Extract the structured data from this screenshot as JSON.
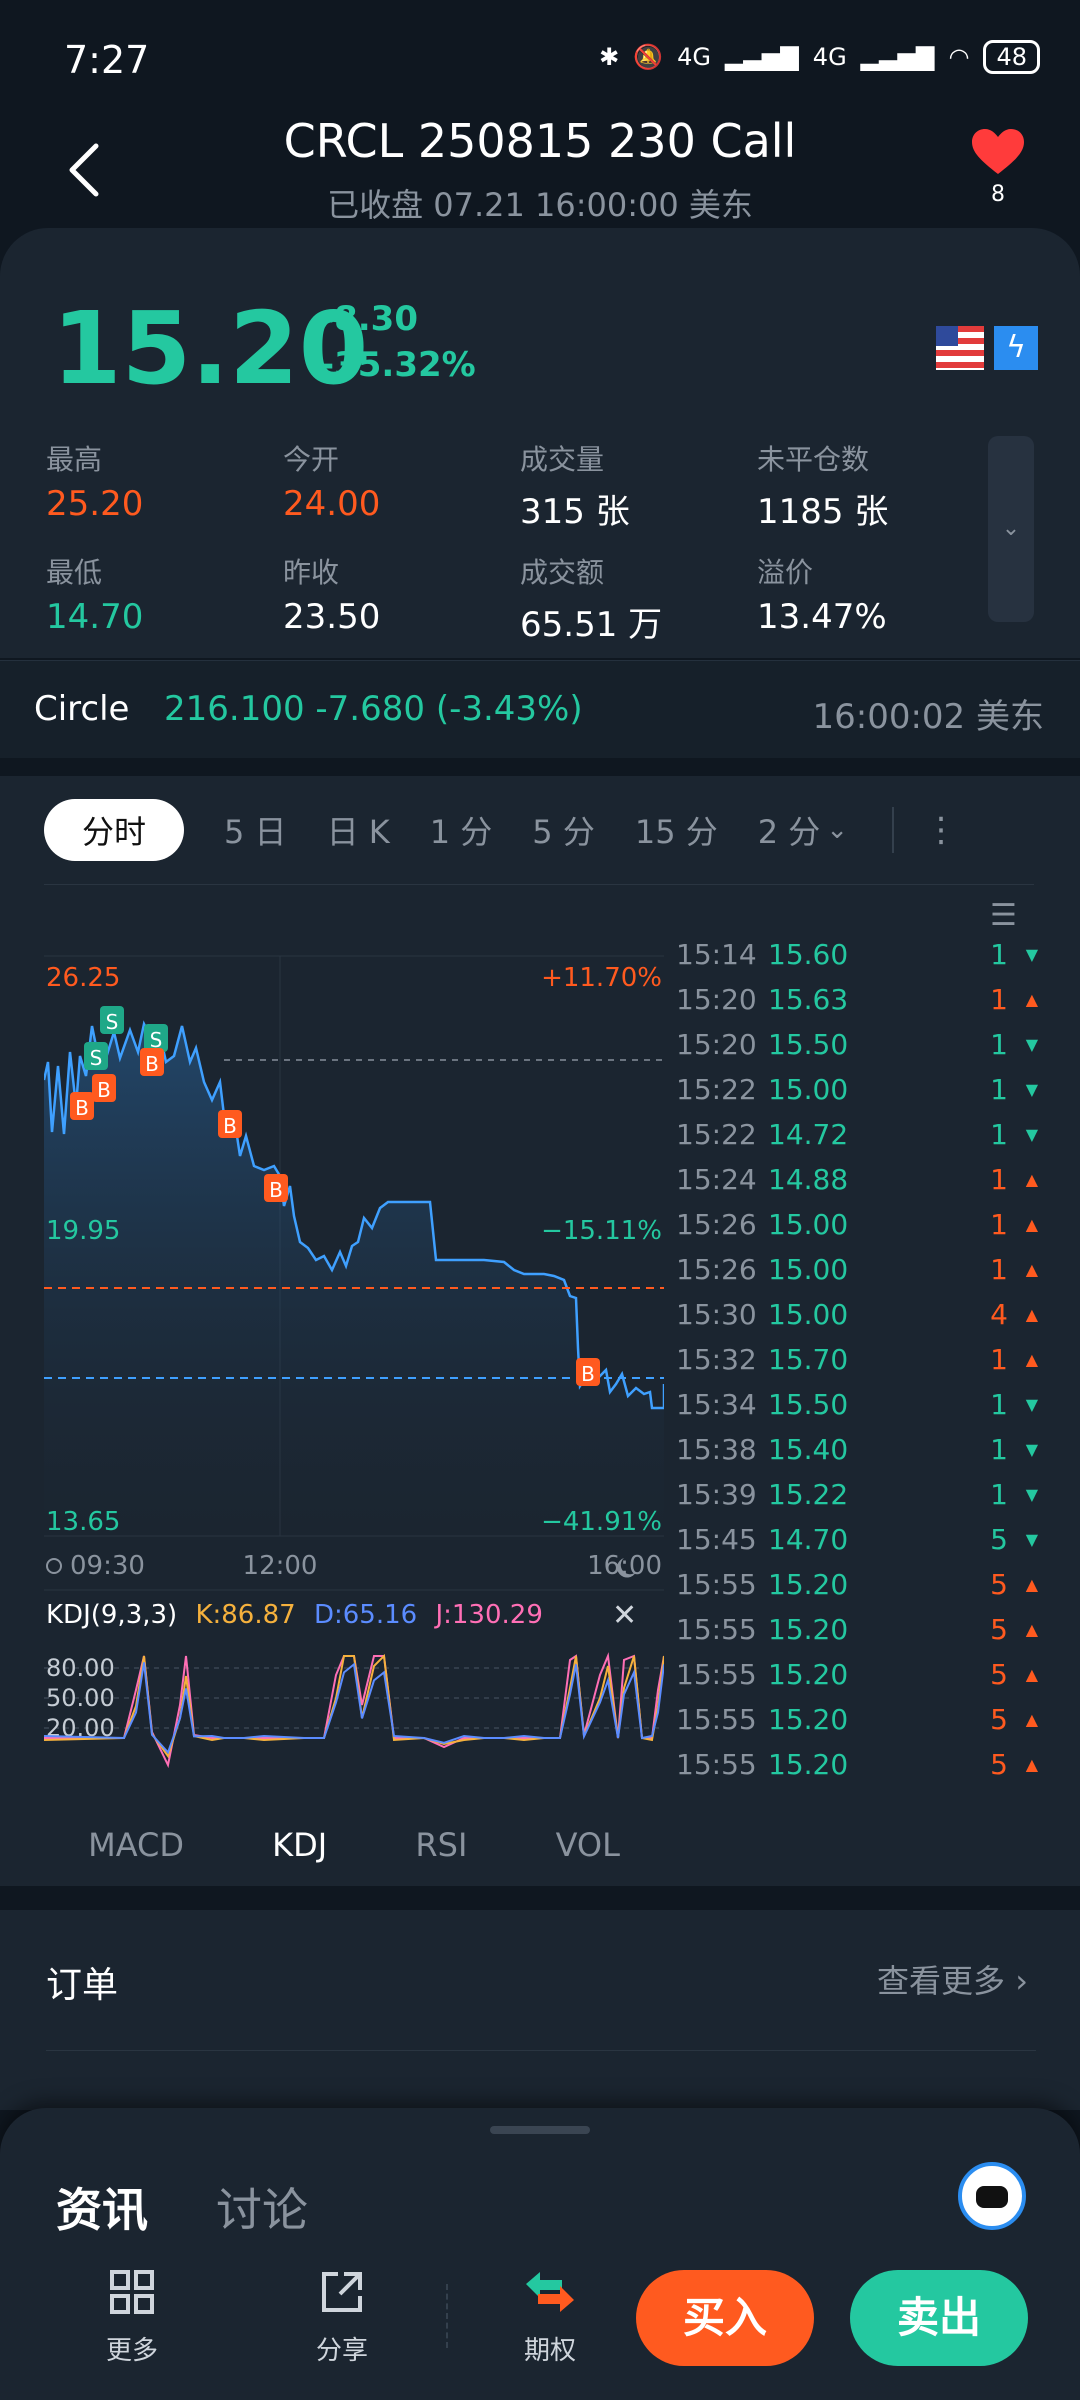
{
  "status": {
    "time": "7:27",
    "battery": "48",
    "net1": "4G",
    "net2": "4G"
  },
  "header": {
    "title": "CRCL 250815 230 Call",
    "subtitle": "已收盘 07.21 16:00:00 美东",
    "fav_count": "8"
  },
  "quote": {
    "price": "15.20",
    "change": "-8.30",
    "change_pct": "-35.32%",
    "stats": [
      {
        "label": "最高",
        "value": "25.20",
        "color": "red"
      },
      {
        "label": "今开",
        "value": "24.00",
        "color": "red"
      },
      {
        "label": "成交量",
        "value": "315 张",
        "color": "white"
      },
      {
        "label": "未平仓数",
        "value": "1185 张",
        "color": "white"
      },
      {
        "label": "最低",
        "value": "14.70",
        "color": "green"
      },
      {
        "label": "昨收",
        "value": "23.50",
        "color": "white"
      },
      {
        "label": "成交额",
        "value": "65.51 万",
        "color": "white"
      },
      {
        "label": "溢价",
        "value": "13.47%",
        "color": "white"
      }
    ]
  },
  "underlying": {
    "name": "Circle",
    "quote": "216.100 -7.680 (-3.43%)",
    "time": "16:00:02 美东"
  },
  "chart_tabs": [
    "分时",
    "5 日",
    "日 K",
    "1 分",
    "5 分",
    "15 分",
    "2 分"
  ],
  "chart": {
    "y_top": "26.25",
    "y_mid": "19.95",
    "y_bot": "13.65",
    "pct_top": "+11.70%",
    "pct_mid": "−15.11%",
    "pct_bot": "−41.91%",
    "x_start": "09:30",
    "x_mid": "12:00",
    "x_end": "16:00"
  },
  "kdj": {
    "name": "KDJ(9,3,3)",
    "k": "K:86.87",
    "d": "D:65.16",
    "j": "J:130.29",
    "levels": [
      "80.00",
      "50.00",
      "20.00"
    ]
  },
  "indicator_tabs": [
    "MACD",
    "KDJ",
    "RSI",
    "VOL"
  ],
  "trades": [
    {
      "time": "15:14",
      "price": "15.60",
      "qty": "1",
      "dir": "down"
    },
    {
      "time": "15:20",
      "price": "15.63",
      "qty": "1",
      "dir": "up"
    },
    {
      "time": "15:20",
      "price": "15.50",
      "qty": "1",
      "dir": "down"
    },
    {
      "time": "15:22",
      "price": "15.00",
      "qty": "1",
      "dir": "down"
    },
    {
      "time": "15:22",
      "price": "14.72",
      "qty": "1",
      "dir": "down"
    },
    {
      "time": "15:24",
      "price": "14.88",
      "qty": "1",
      "dir": "up"
    },
    {
      "time": "15:26",
      "price": "15.00",
      "qty": "1",
      "dir": "up"
    },
    {
      "time": "15:26",
      "price": "15.00",
      "qty": "1",
      "dir": "up"
    },
    {
      "time": "15:30",
      "price": "15.00",
      "qty": "4",
      "dir": "up"
    },
    {
      "time": "15:32",
      "price": "15.70",
      "qty": "1",
      "dir": "up"
    },
    {
      "time": "15:34",
      "price": "15.50",
      "qty": "1",
      "dir": "down"
    },
    {
      "time": "15:38",
      "price": "15.40",
      "qty": "1",
      "dir": "down"
    },
    {
      "time": "15:39",
      "price": "15.22",
      "qty": "1",
      "dir": "down"
    },
    {
      "time": "15:45",
      "price": "14.70",
      "qty": "5",
      "dir": "down"
    },
    {
      "time": "15:55",
      "price": "15.20",
      "qty": "5",
      "dir": "up"
    },
    {
      "time": "15:55",
      "price": "15.20",
      "qty": "5",
      "dir": "up"
    },
    {
      "time": "15:55",
      "price": "15.20",
      "qty": "5",
      "dir": "up"
    },
    {
      "time": "15:55",
      "price": "15.20",
      "qty": "5",
      "dir": "up"
    },
    {
      "time": "15:55",
      "price": "15.20",
      "qty": "5",
      "dir": "up"
    }
  ],
  "orders": {
    "title": "订单",
    "more": "查看更多"
  },
  "sheet": {
    "tab_news": "资讯",
    "tab_discuss": "讨论",
    "actions": [
      "更多",
      "分享",
      "期权"
    ],
    "buy": "买入",
    "sell": "卖出"
  }
}
